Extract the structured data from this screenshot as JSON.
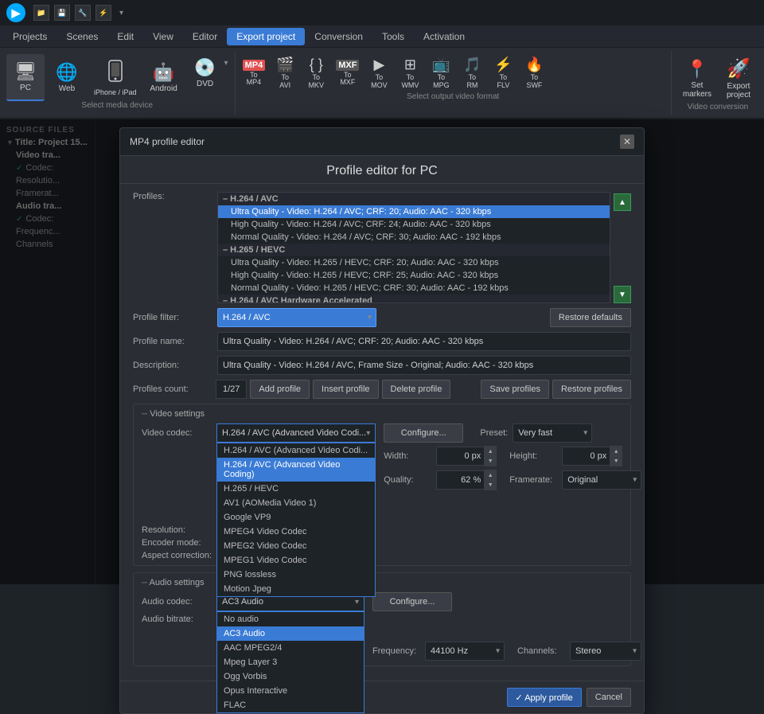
{
  "titlebar": {
    "logo": "M",
    "icons": [
      "📁",
      "💾",
      "🔧",
      "⚡",
      "▾"
    ]
  },
  "menubar": {
    "items": [
      "Projects",
      "Scenes",
      "Edit",
      "View",
      "Editor",
      "Export project",
      "Conversion",
      "Tools",
      "Activation"
    ],
    "active": "Export project"
  },
  "toolbar": {
    "device_label": "Select media device",
    "output_label": "Select output video format",
    "action_label": "Video conversion",
    "devices": [
      {
        "icon": "🖥",
        "label": "PC"
      },
      {
        "icon": "🌐",
        "label": "Web"
      },
      {
        "icon": "",
        "label": "iPhone / iPad"
      },
      {
        "icon": "🤖",
        "label": "Android"
      },
      {
        "icon": "💿",
        "label": "DVD"
      }
    ],
    "outputs": [
      {
        "label": "To\nMP4",
        "icon": "MP4"
      },
      {
        "label": "To\nAVI",
        "icon": "AVI"
      },
      {
        "label": "To\nMKV",
        "icon": "MKV"
      },
      {
        "label": "To\nMXF",
        "icon": "MXF"
      },
      {
        "label": "To\nMOV",
        "icon": "▶"
      },
      {
        "label": "To\nWMV",
        "icon": "WMV"
      },
      {
        "label": "To\nMPG",
        "icon": "MPG"
      },
      {
        "label": "To\nRM",
        "icon": "RM"
      },
      {
        "label": "To\nFLV",
        "icon": "FLV"
      },
      {
        "label": "To\nSWF",
        "icon": "SWF"
      }
    ],
    "actions": [
      {
        "label": "Set\nmarkers",
        "icon": "📍"
      },
      {
        "label": "Export\nproject",
        "icon": "🚀"
      }
    ]
  },
  "sidebar": {
    "header": "SOURCE FILES",
    "items": [
      {
        "label": "Title: Project 15...",
        "indent": false,
        "bold": true,
        "check": false
      },
      {
        "label": "Video tra...",
        "indent": true,
        "bold": true,
        "check": false
      },
      {
        "label": "Codec:",
        "indent": true,
        "bold": false,
        "check": true
      },
      {
        "label": "Resolutio...",
        "indent": true,
        "bold": false,
        "check": false
      },
      {
        "label": "Framerat...",
        "indent": true,
        "bold": false,
        "check": false
      },
      {
        "label": "Audio tra...",
        "indent": true,
        "bold": true,
        "check": false
      },
      {
        "label": "Codec:",
        "indent": true,
        "bold": false,
        "check": true
      },
      {
        "label": "Frequenc...",
        "indent": true,
        "bold": false,
        "check": false
      },
      {
        "label": "Channels",
        "indent": true,
        "bold": false,
        "check": false
      }
    ]
  },
  "modal": {
    "titlebar": "MP4 profile editor",
    "heading": "Profile editor for PC",
    "profiles_label": "Profiles:",
    "profile_filter_label": "Profile filter:",
    "profile_name_label": "Profile name:",
    "description_label": "Description:",
    "profiles_count_label": "Profiles count:",
    "profiles_count": "1/27",
    "restore_defaults": "Restore defaults",
    "add_profile": "Add profile",
    "insert_profile": "Insert profile",
    "delete_profile": "Delete profile",
    "save_profiles": "Save profiles",
    "restore_profiles": "Restore profiles",
    "profile_filter_value": "H.264 / AVC",
    "profile_name_value": "Ultra Quality - Video: H.264 / AVC; CRF: 20; Audio: AAC - 320 kbps",
    "description_value": "Ultra Quality - Video: H.264 / AVC, Frame Size - Original; Audio: AAC - 320 kbps",
    "profile_groups": [
      {
        "name": "H.264 / AVC",
        "items": [
          {
            "label": "Ultra Quality - Video: H.264 / AVC; CRF: 20; Audio: AAC - 320 kbps",
            "selected": true
          },
          {
            "label": "High Quality - Video: H.264 / AVC; CRF: 24; Audio: AAC - 320 kbps",
            "selected": false
          },
          {
            "label": "Normal Quality - Video: H.264 / AVC; CRF: 30; Audio: AAC - 192 kbps",
            "selected": false
          }
        ]
      },
      {
        "name": "H.265 / HEVC",
        "items": [
          {
            "label": "Ultra Quality - Video: H.265 / HEVC; CRF: 20; Audio: AAC - 320 kbps",
            "selected": false
          },
          {
            "label": "High Quality - Video: H.265 / HEVC; CRF: 25; Audio: AAC - 320 kbps",
            "selected": false
          },
          {
            "label": "Normal Quality - Video: H.265 / HEVC; CRF: 30; Audio: AAC - 192 kbps",
            "selected": false
          }
        ]
      },
      {
        "name": "H.264 / AVC Hardware Accelerated",
        "items": []
      }
    ],
    "video_settings": {
      "section_title": "Video settings",
      "codec_label": "Video codec:",
      "codec_value": "H.264 / AVC (Advanced Video Codi...",
      "codec_options": [
        "H.264 / AVC (Advanced Video Coding)",
        "H.265 / HEVC",
        "AV1 (AOMedia Video 1)",
        "Google VP9",
        "MPEG4 Video Codec",
        "MPEG2 Video Codec",
        "MPEG1 Video Codec",
        "PNG lossless",
        "Motion Jpeg"
      ],
      "codec_selected": "H.264 / AVC (Advanced Video Coding)",
      "configure_btn": "Configure...",
      "preset_label": "Preset:",
      "preset_value": "Very fast",
      "resolution_label": "Resolution:",
      "width_label": "Width:",
      "width_value": "0 px",
      "height_label": "Height:",
      "height_value": "0 px",
      "encoder_label": "Encoder mode:",
      "quality_label": "Quality:",
      "quality_value": "62 %",
      "framerate_label": "Framerate:",
      "framerate_value": "Original",
      "aspect_label": "Aspect correction:"
    },
    "audio_settings": {
      "section_title": "Audio settings",
      "codec_label": "Audio codec:",
      "codec_value": "AC3 Audio",
      "codec_options": [
        "No audio",
        "AC3 Audio",
        "AAC MPEG2/4",
        "Mpeg Layer 3",
        "Ogg Vorbis",
        "Opus Interactive",
        "FLAC"
      ],
      "codec_selected": "AC3 Audio",
      "configure_btn": "Configure...",
      "frequency_label": "Frequency:",
      "frequency_value": "44100 Hz",
      "channels_label": "Channels:",
      "channels_value": "Stereo",
      "bitrate_label": "Audio bitrate:"
    },
    "footer": {
      "apply_btn": "✓  Apply profile",
      "cancel_btn": "Cancel"
    }
  }
}
